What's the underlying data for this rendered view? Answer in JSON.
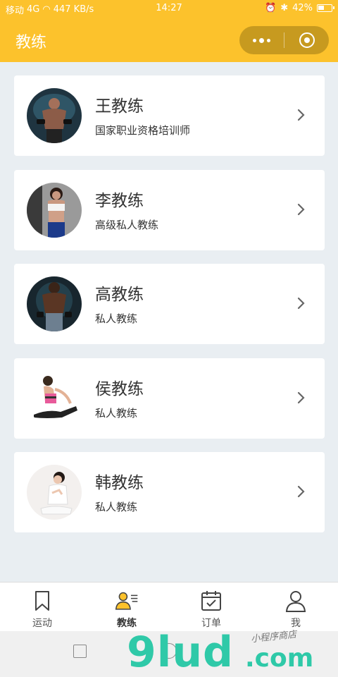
{
  "status_bar": {
    "carrier": "移动",
    "signal_text": "4G",
    "speed": "447 KB/s",
    "time": "14:27",
    "battery": "42%"
  },
  "header": {
    "title": "教练"
  },
  "coaches": [
    {
      "name": "王教练",
      "desc": "国家职业资格培训师"
    },
    {
      "name": "李教练",
      "desc": "高级私人教练"
    },
    {
      "name": "高教练",
      "desc": "私人教练"
    },
    {
      "name": "侯教练",
      "desc": "私人教练"
    },
    {
      "name": "韩教练",
      "desc": "私人教练"
    }
  ],
  "tabbar": {
    "tabs": [
      {
        "label": "运动",
        "icon": "bookmark-icon",
        "active": false
      },
      {
        "label": "教练",
        "icon": "coach-icon",
        "active": true
      },
      {
        "label": "订单",
        "icon": "calendar-check-icon",
        "active": false
      },
      {
        "label": "我",
        "icon": "user-icon",
        "active": false
      }
    ]
  },
  "watermark": {
    "brand": "9lud",
    "suffix": ".com",
    "tagline": "小程序商店"
  },
  "colors": {
    "brand_yellow": "#fcc22c",
    "capsule": "#c79a1f",
    "background": "#e9eef2",
    "watermark": "#2fc9a8"
  }
}
